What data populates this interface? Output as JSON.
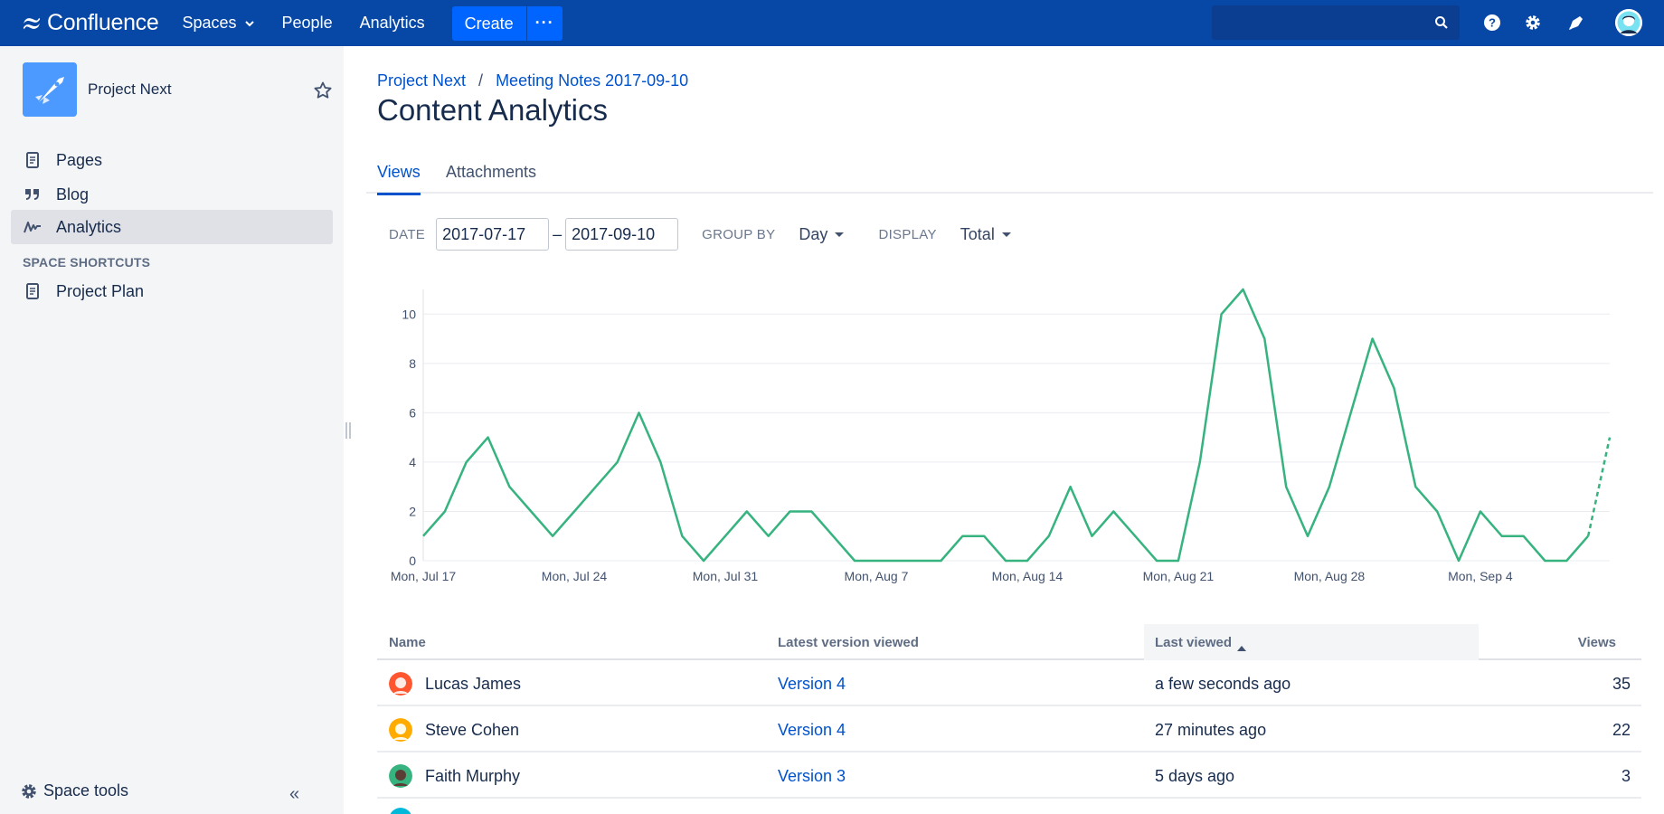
{
  "topbar": {
    "logo_text": "Confluence",
    "nav": [
      {
        "label": "Spaces",
        "has_dropdown": true
      },
      {
        "label": "People"
      },
      {
        "label": "Analytics"
      }
    ],
    "create_label": "Create",
    "more_label": "···",
    "search": {
      "placeholder": "",
      "value": ""
    },
    "icons": [
      "help-icon",
      "settings-icon",
      "notifications-icon",
      "user-avatar"
    ]
  },
  "sidebar": {
    "space_name": "Project Next",
    "items": [
      {
        "label": "Pages",
        "icon": "page-icon"
      },
      {
        "label": "Blog",
        "icon": "quote-icon"
      },
      {
        "label": "Analytics",
        "icon": "analytics-icon",
        "active": true
      }
    ],
    "shortcuts_title": "SPACE SHORTCUTS",
    "shortcuts": [
      {
        "label": "Project Plan",
        "icon": "page-icon"
      }
    ],
    "space_tools_label": "Space tools",
    "collapse_label": "«"
  },
  "breadcrumb": {
    "items": [
      "Project Next",
      "Meeting Notes 2017-09-10"
    ],
    "separator": "/"
  },
  "page_title": "Content Analytics",
  "tabs": [
    {
      "label": "Views",
      "active": true
    },
    {
      "label": "Attachments",
      "active": false
    }
  ],
  "filters": {
    "date_label": "DATE",
    "date_from": "2017-07-17",
    "date_to": "2017-09-10",
    "dash": "–",
    "group_by_label": "GROUP BY",
    "group_by_value": "Day",
    "display_label": "DISPLAY",
    "display_value": "Total"
  },
  "colors": {
    "accent": "#0052cc",
    "topbar": "#0747a6",
    "line": "#36b37e"
  },
  "chart_data": {
    "type": "line",
    "x_start": "Mon, Jul 17",
    "x_tick_labels": [
      "Mon, Jul 17",
      "Mon, Jul 24",
      "Mon, Jul 31",
      "Mon, Aug 7",
      "Mon, Aug 14",
      "Mon, Aug 21",
      "Mon, Aug 28",
      "Mon, Sep 4"
    ],
    "y_ticks": [
      0,
      2,
      4,
      6,
      8,
      10
    ],
    "ylim": [
      0,
      11
    ],
    "grid": true,
    "series": [
      {
        "values": [
          1,
          2,
          4,
          5,
          3,
          2,
          1,
          2,
          3,
          4,
          6,
          4,
          1,
          0,
          1,
          2,
          1,
          2,
          2,
          1,
          0,
          0,
          0,
          0,
          0,
          1,
          1,
          0,
          0,
          1,
          3,
          1,
          2,
          1,
          0,
          0,
          4,
          10,
          11,
          9,
          3,
          1,
          3,
          6,
          9,
          7,
          3,
          2,
          0,
          2,
          1,
          1,
          0,
          0,
          1,
          5
        ],
        "last_segment_dashed": true
      }
    ]
  },
  "table": {
    "headers": {
      "name": "Name",
      "version": "Latest version viewed",
      "last_viewed": "Last viewed",
      "views": "Views"
    },
    "rows": [
      {
        "name": "Lucas James",
        "version": "Version 4",
        "last_viewed": "a few seconds ago",
        "views": "35",
        "avatar_color": "#ff5630"
      },
      {
        "name": "Steve Cohen",
        "version": "Version 4",
        "last_viewed": "27 minutes ago",
        "views": "22",
        "avatar_color": "#ffab00"
      },
      {
        "name": "Faith Murphy",
        "version": "Version 3",
        "last_viewed": "5 days ago",
        "views": "3",
        "avatar_color": "#36b37e"
      }
    ]
  }
}
